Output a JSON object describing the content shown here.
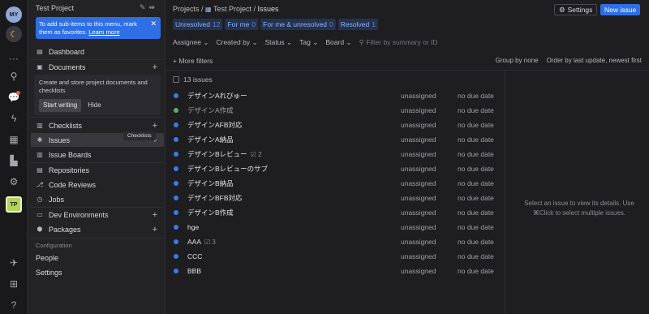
{
  "rail": {
    "avatar_user": "MY",
    "avatar_project": "TP"
  },
  "sidebar": {
    "title": "Test Project",
    "hint": {
      "text": "To add sub-items to this menu, mark them as favorites.",
      "link": "Learn more"
    },
    "items": {
      "dashboard": "Dashboard",
      "documents": "Documents",
      "checklists": "Checklists",
      "issues": "Issues",
      "issue_boards": "Issue Boards",
      "repositories": "Repositories",
      "code_reviews": "Code Reviews",
      "jobs": "Jobs",
      "dev_environments": "Dev Environments",
      "packages": "Packages"
    },
    "doc_card": {
      "text": "Create and store project documents and checklists",
      "start": "Start writing",
      "hide": "Hide"
    },
    "tooltip": "Checklists",
    "configuration": {
      "label": "Configuration",
      "people": "People",
      "settings": "Settings"
    }
  },
  "header": {
    "crumb_projects": "Projects",
    "crumb_project": "Test Project",
    "crumb_page": "Issues",
    "settings_label": "Settings",
    "new_issue_label": "New issue"
  },
  "tabs": [
    {
      "label": "Unresolved",
      "count": "12"
    },
    {
      "label": "For me",
      "count": "0"
    },
    {
      "label": "For me & unresolved",
      "count": "0"
    },
    {
      "label": "Resolved",
      "count": "1"
    }
  ],
  "filters": {
    "assignee": "Assignee",
    "created_by": "Created by",
    "status": "Status",
    "tag": "Tag",
    "board": "Board",
    "search_placeholder": "Filter by summary or ID",
    "more_filters": "+ More filters",
    "group_by": "Group by none",
    "order_by": "Order by last update, newest first"
  },
  "list": {
    "count_label": "13 issues",
    "issues": [
      {
        "title": "デザインAれびゅー",
        "status_color": "#3b7bea",
        "muted": false,
        "sub": "",
        "assignee": "unassigned",
        "due": "no due date"
      },
      {
        "title": "デザインA作成",
        "status_color": "#58b35e",
        "muted": true,
        "sub": "",
        "assignee": "unassigned",
        "due": "no due date"
      },
      {
        "title": "デザインAFB対応",
        "status_color": "#3b7bea",
        "muted": false,
        "sub": "",
        "assignee": "unassigned",
        "due": "no due date"
      },
      {
        "title": "デザインA納品",
        "status_color": "#3b7bea",
        "muted": false,
        "sub": "",
        "assignee": "unassigned",
        "due": "no due date"
      },
      {
        "title": "デザインBレビュー",
        "status_color": "#3b7bea",
        "muted": false,
        "sub": "2",
        "assignee": "unassigned",
        "due": "no due date"
      },
      {
        "title": "デザインBレビューのサブ",
        "status_color": "#3b7bea",
        "muted": false,
        "sub": "",
        "assignee": "unassigned",
        "due": "no due date"
      },
      {
        "title": "デザインB納品",
        "status_color": "#3b7bea",
        "muted": false,
        "sub": "",
        "assignee": "unassigned",
        "due": "no due date"
      },
      {
        "title": "デザインBFB対応",
        "status_color": "#3b7bea",
        "muted": false,
        "sub": "",
        "assignee": "unassigned",
        "due": "no due date"
      },
      {
        "title": "デザインB作成",
        "status_color": "#3b7bea",
        "muted": false,
        "sub": "",
        "assignee": "unassigned",
        "due": "no due date"
      },
      {
        "title": "hge",
        "status_color": "#3b7bea",
        "muted": false,
        "sub": "",
        "assignee": "unassigned",
        "due": "no due date"
      },
      {
        "title": "AAA",
        "status_color": "#3b7bea",
        "muted": false,
        "sub": "3",
        "assignee": "unassigned",
        "due": "no due date"
      },
      {
        "title": "CCC",
        "status_color": "#3b7bea",
        "muted": false,
        "sub": "",
        "assignee": "unassigned",
        "due": "no due date"
      },
      {
        "title": "BBB",
        "status_color": "#3b7bea",
        "muted": false,
        "sub": "",
        "assignee": "unassigned",
        "due": "no due date"
      }
    ]
  },
  "detail": {
    "empty_text": "Select an issue to view its details. Use ⌘Click to select multiple issues."
  }
}
